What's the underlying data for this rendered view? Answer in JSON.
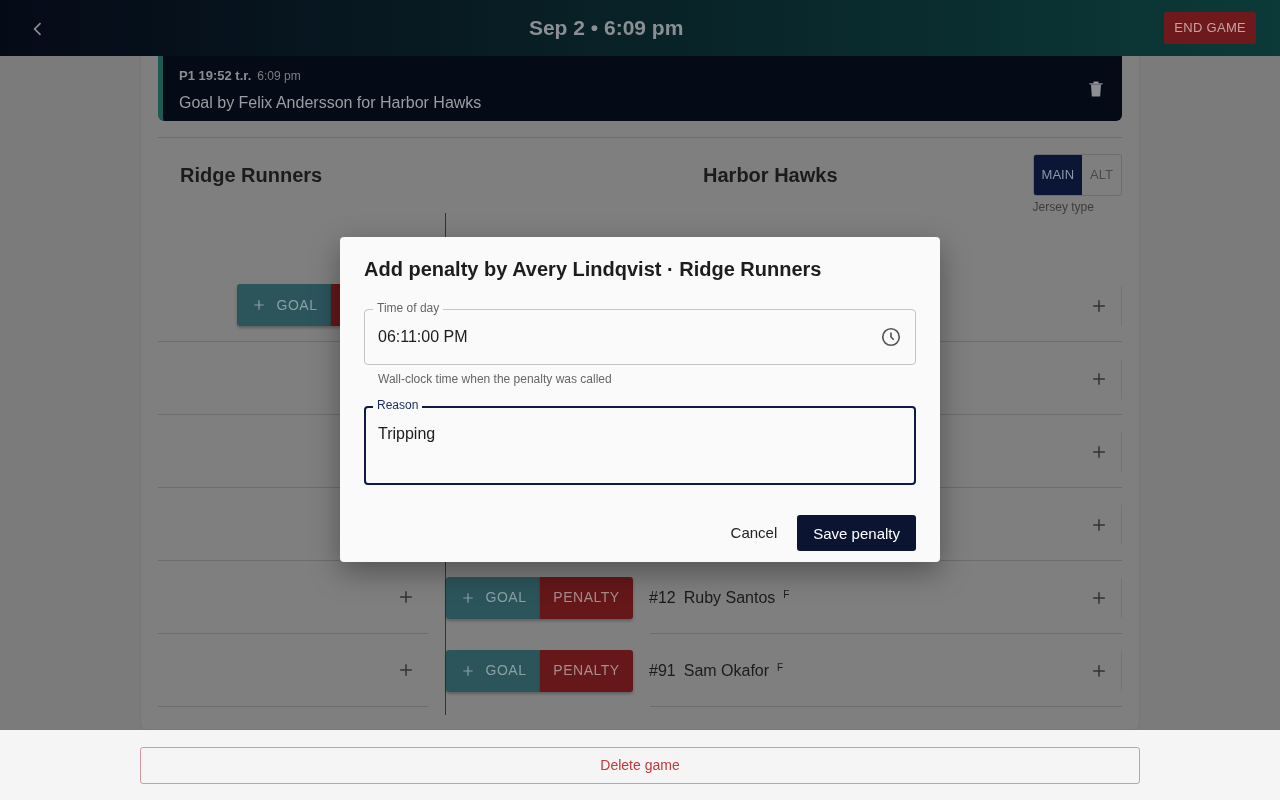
{
  "header": {
    "title": "Sep 2 • 6:09 pm",
    "end_button": "END GAME"
  },
  "event": {
    "period_time": "P1 19:52 t.r.",
    "clock_time": "6:09 pm",
    "text": "Goal by Felix Andersson for Harbor Hawks"
  },
  "teams": [
    {
      "name": "Ridge Runners"
    },
    {
      "name": "Harbor Hawks"
    }
  ],
  "jersey_toggle": {
    "options": [
      {
        "label": "MAIN",
        "selected": true
      },
      {
        "label": "ALT",
        "selected": false
      }
    ],
    "caption": "Jersey type"
  },
  "left_rows": [
    {
      "goal": "GOAL",
      "has_penalty": true,
      "add": false
    },
    {
      "add": false
    },
    {
      "add": false
    },
    {
      "add": false
    },
    {
      "add": true
    },
    {
      "add": true
    }
  ],
  "right_rows": [
    {
      "add": true
    },
    {
      "add": true
    },
    {
      "add": true
    },
    {
      "add": true
    },
    {
      "goal": "GOAL",
      "penalty": "PENALTY",
      "number": "#12",
      "name": "Ruby Santos",
      "position": "F",
      "add": true
    },
    {
      "goal": "GOAL",
      "penalty": "PENALTY",
      "number": "#91",
      "name": "Sam Okafor",
      "position": "F",
      "add": true
    }
  ],
  "dialog": {
    "title": "Add penalty by Avery Lindqvist · Ridge Runners",
    "time_field": {
      "label": "Time of day",
      "value": "06:11:00 PM",
      "helper": "Wall-clock time when the penalty was called"
    },
    "reason_field": {
      "label": "Reason",
      "value": "Tripping",
      "focused": true
    },
    "cancel": "Cancel",
    "save": "Save penalty"
  },
  "delete_button": "Delete game"
}
